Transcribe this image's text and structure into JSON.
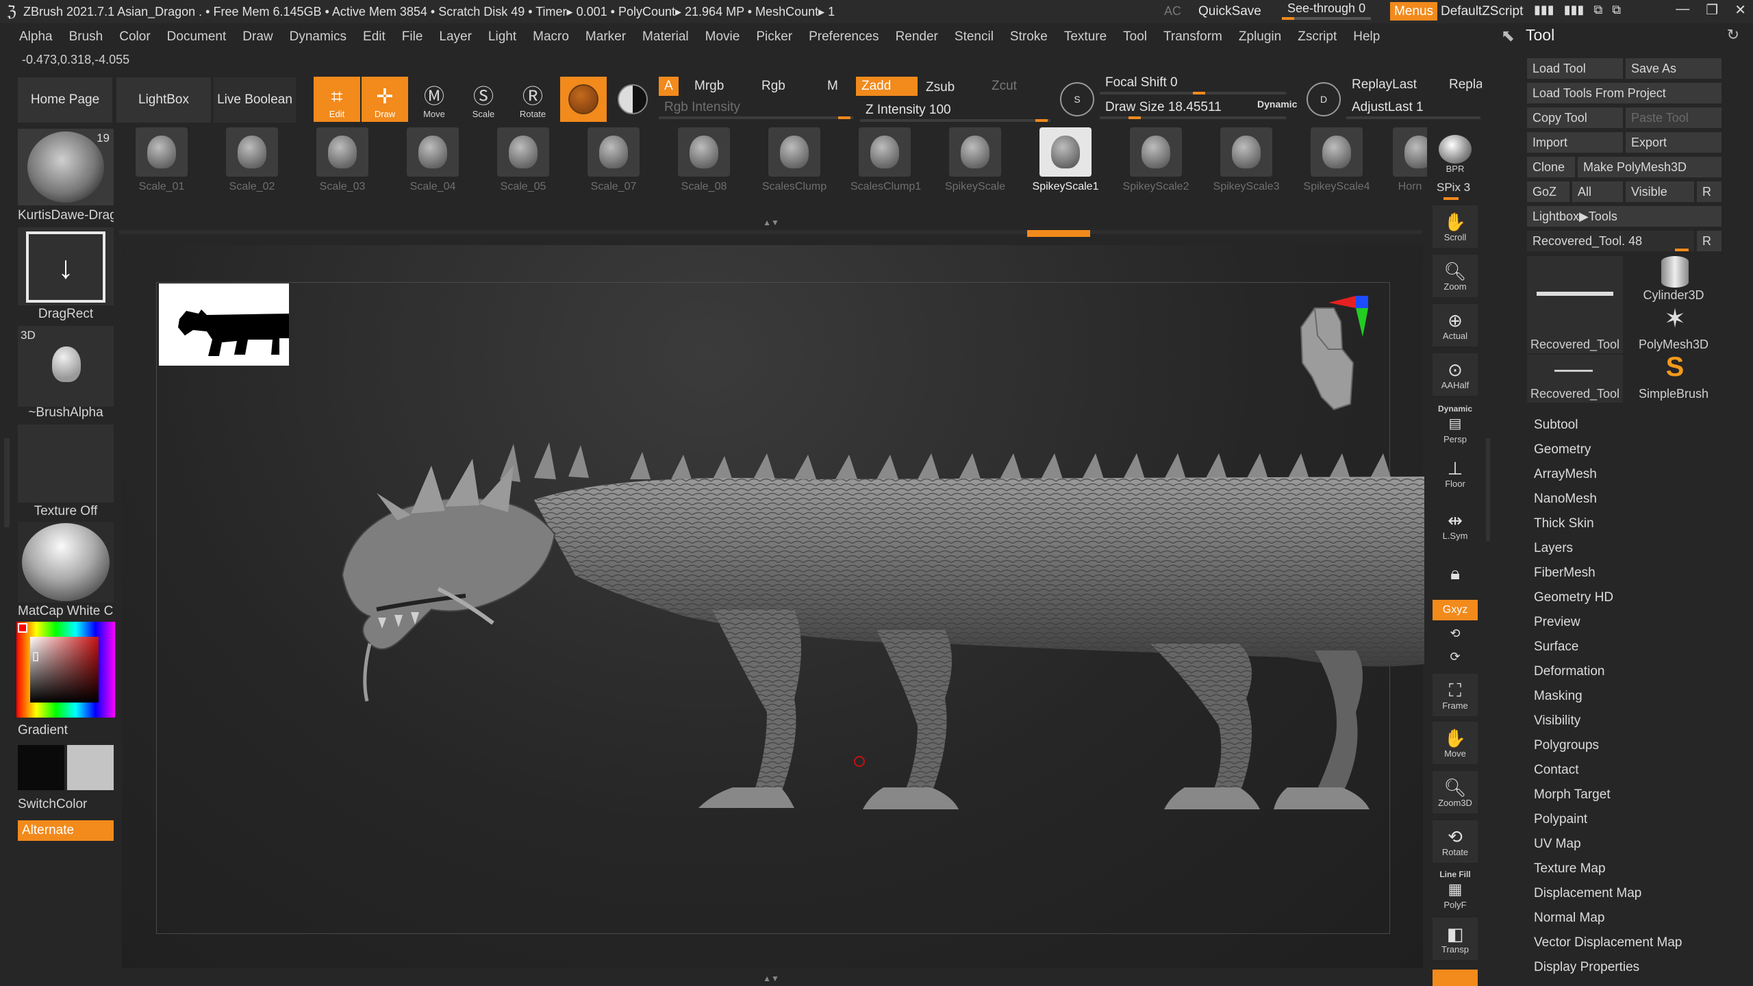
{
  "titlebar": {
    "title": "ZBrush 2021.7.1    Asian_Dragon   . • Free Mem 6.145GB • Active Mem 3854 • Scratch Disk 49 •  Timer▸ 0.001 • PolyCount▸ 21.964 MP   • MeshCount▸ 1",
    "ac": "AC",
    "quicksave": "QuickSave",
    "see_through": "See-through  0",
    "see_through_value": 0,
    "menus": "Menus",
    "default_zscript": "DefaultZScript"
  },
  "menubar": {
    "items": [
      "Alpha",
      "Brush",
      "Color",
      "Document",
      "Draw",
      "Dynamics",
      "Edit",
      "File",
      "Layer",
      "Light",
      "Macro",
      "Marker",
      "Material",
      "Movie",
      "Picker",
      "Preferences",
      "Render",
      "Stencil",
      "Stroke",
      "Texture",
      "Tool",
      "Transform",
      "Zplugin",
      "Zscript",
      "Help"
    ]
  },
  "coords": "-0.473,0.318,-4.055",
  "shelf": {
    "home_page": "Home Page",
    "lightbox": "LightBox",
    "live_boolean": "Live Boolean",
    "edit": "Edit",
    "draw": "Draw",
    "move": "Move",
    "scale": "Scale",
    "rotate": "Rotate",
    "a": "A",
    "mrgb": "Mrgb",
    "rgb": "Rgb",
    "m": "M",
    "zadd": "Zadd",
    "zsub": "Zsub",
    "zcut": "Zcut",
    "rgb_intensity": "Rgb Intensity",
    "z_intensity": "Z Intensity 100",
    "focal_shift": "Focal Shift 0",
    "draw_size": "Draw Size 18.45511",
    "dynamic": "Dynamic",
    "replay_last": "ReplayLast",
    "repl": "Repla",
    "adjust_last": "AdjustLast 1",
    "s_label": "S",
    "d_label": "D"
  },
  "left_tray": {
    "brush_count": "19",
    "brush_name": "KurtisDawe-Drag",
    "stroke_name": "DragRect",
    "alpha_tag": "3D",
    "alpha_name": "~BrushAlpha",
    "texture_name": "Texture Off",
    "material_name": "MatCap White Cav",
    "gradient": "Gradient",
    "switch_color": "SwitchColor",
    "alternate": "Alternate"
  },
  "brushes": [
    {
      "name": "Scale_01"
    },
    {
      "name": "Scale_02"
    },
    {
      "name": "Scale_03"
    },
    {
      "name": "Scale_04"
    },
    {
      "name": "Scale_05"
    },
    {
      "name": "Scale_07"
    },
    {
      "name": "Scale_08"
    },
    {
      "name": "ScalesClump"
    },
    {
      "name": "ScalesClump1"
    },
    {
      "name": "SpikeyScale"
    },
    {
      "name": "SpikeyScale1"
    },
    {
      "name": "SpikeyScale2"
    },
    {
      "name": "SpikeyScale3"
    },
    {
      "name": "SpikeyScale4"
    },
    {
      "name": "Horn"
    }
  ],
  "selected_brush": "SpikeyScale1",
  "right_dock": {
    "bpr": "BPR",
    "spix": "SPix 3",
    "scroll": "Scroll",
    "zoom": "Zoom",
    "actual": "Actual",
    "aahalf": "AAHalf",
    "dynamic": "Dynamic",
    "persp": "Persp",
    "floor": "Floor",
    "lsym": "L.Sym",
    "xyz": "Gxyz",
    "frame": "Frame",
    "move": "Move",
    "zoom3d": "Zoom3D",
    "rotate": "Rotate",
    "line_fill": "Line Fill",
    "polyf": "PolyF",
    "transp": "Transp"
  },
  "tool_panel": {
    "title": "Tool",
    "load_tool": "Load Tool",
    "save_as": "Save As",
    "load_from_project": "Load Tools From Project",
    "copy_tool": "Copy Tool",
    "paste_tool": "Paste Tool",
    "import": "Import",
    "export": "Export",
    "clone": "Clone",
    "make_polymesh": "Make PolyMesh3D",
    "goz": "GoZ",
    "all": "All",
    "visible": "Visible",
    "r": "R",
    "lightbox_tools": "Lightbox▶Tools",
    "recovered_tool_slider": "Recovered_Tool. 48",
    "thumbs": [
      "Recovered_Tool",
      "Cylinder3D",
      "PolyMesh3D",
      "Recovered_Tool",
      "SimpleBrush"
    ],
    "subpalettes": [
      "Subtool",
      "Geometry",
      "ArrayMesh",
      "NanoMesh",
      "Thick Skin",
      "Layers",
      "FiberMesh",
      "Geometry HD",
      "Preview",
      "Surface",
      "Deformation",
      "Masking",
      "Visibility",
      "Polygroups",
      "Contact",
      "Morph Target",
      "Polypaint",
      "UV Map",
      "Texture Map",
      "Displacement Map",
      "Normal Map",
      "Vector Displacement Map",
      "Display Properties"
    ]
  },
  "colors": {
    "accent": "#f28a1c",
    "background": "#262626",
    "panel": "#303030"
  }
}
